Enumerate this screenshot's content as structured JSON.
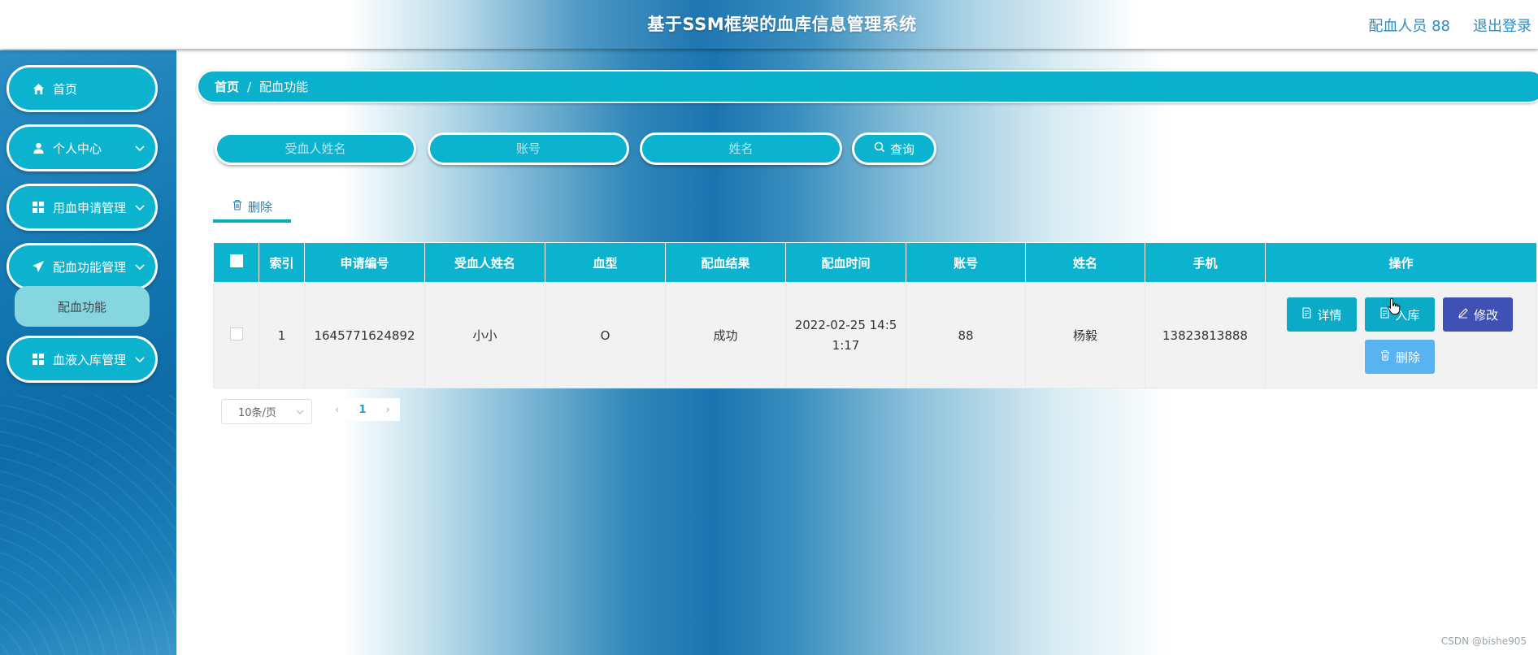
{
  "header": {
    "title": "基于SSM框架的血库信息管理系统",
    "user": "配血人员 88",
    "logout": "退出登录"
  },
  "sidebar": {
    "items": [
      {
        "label": "首页",
        "icon": "home-icon"
      },
      {
        "label": "个人中心",
        "icon": "user-icon"
      },
      {
        "label": "用血申请管理",
        "icon": "grid-icon"
      },
      {
        "label": "配血功能管理",
        "icon": "send-icon"
      },
      {
        "label": "血液入库管理",
        "icon": "grid-icon"
      }
    ],
    "submenu_active": "配血功能"
  },
  "breadcrumb": {
    "home": "首页",
    "separator": "/",
    "current": "配血功能"
  },
  "search": {
    "recipient_placeholder": "受血人姓名",
    "account_placeholder": "账号",
    "name_placeholder": "姓名",
    "button": "查询"
  },
  "toolbar": {
    "delete": "删除"
  },
  "table": {
    "columns": [
      "索引",
      "申请编号",
      "受血人姓名",
      "血型",
      "配血结果",
      "配血时间",
      "账号",
      "姓名",
      "手机",
      "操作"
    ],
    "rows": [
      {
        "index": "1",
        "apply_no": "1645771624892",
        "recipient": "小小",
        "blood_type": "O",
        "result": "成功",
        "time": "2022-02-25 14:51:17",
        "account": "88",
        "name": "杨毅",
        "phone": "13823813888"
      }
    ],
    "actions": {
      "detail": "详情",
      "stock_in": "入库",
      "edit": "修改",
      "delete": "删除"
    }
  },
  "pagination": {
    "page_size": "10条/页",
    "prev": "‹",
    "current": "1",
    "next": "›"
  },
  "watermark": "CSDN @bishe905",
  "colors": {
    "accent": "#0bb3cf",
    "edit": "#3f51b5",
    "delete": "#5ab3f1",
    "header_text": "#2d8cc0"
  }
}
